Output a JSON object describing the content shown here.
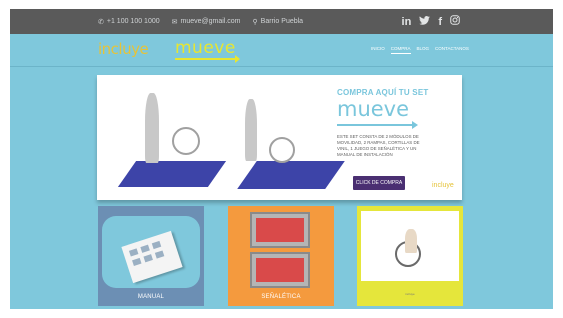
{
  "topbar": {
    "phone": "+1 100 100 1000",
    "email": "mueve@gmail.com",
    "location": "Barrio Puebla",
    "social_icons": [
      "linkedin-icon",
      "twitter-icon",
      "facebook-icon",
      "instagram-icon"
    ]
  },
  "header": {
    "logo_incluye": "incluye",
    "logo_mueve": "mueve",
    "nav": [
      "INICIO",
      "COMPRA",
      "BLOG",
      "CONTACTANOS"
    ],
    "active_nav": "COMPRA"
  },
  "hero": {
    "title": "COMPRA AQUÍ TU SET",
    "brand": "mueve",
    "description": "ESTE SET CONSTA DE 2 MÓDULOS DE MOVILIDAD, 2 RAMPAS, CORTILLAS DE VINIL, 1 JUEGO DE SEÑALÉTICA Y UN MANUAL DE INSTALACIÓN",
    "button": "CLICK DE COMPRA",
    "logo": "incluye"
  },
  "cards": [
    {
      "label": "MANUAL"
    },
    {
      "label": "SEÑALÉTICA"
    },
    {
      "label": "",
      "small": "incluye"
    }
  ],
  "colors": {
    "frame_bg": "#7fc8dc",
    "topbar_bg": "#5a5a5a",
    "accent_yellow": "#e8e62f",
    "button_purple": "#4a2f72",
    "card_blue": "#6c8fb4",
    "card_orange": "#f49a3e",
    "card_yellow": "#e5e63b"
  }
}
